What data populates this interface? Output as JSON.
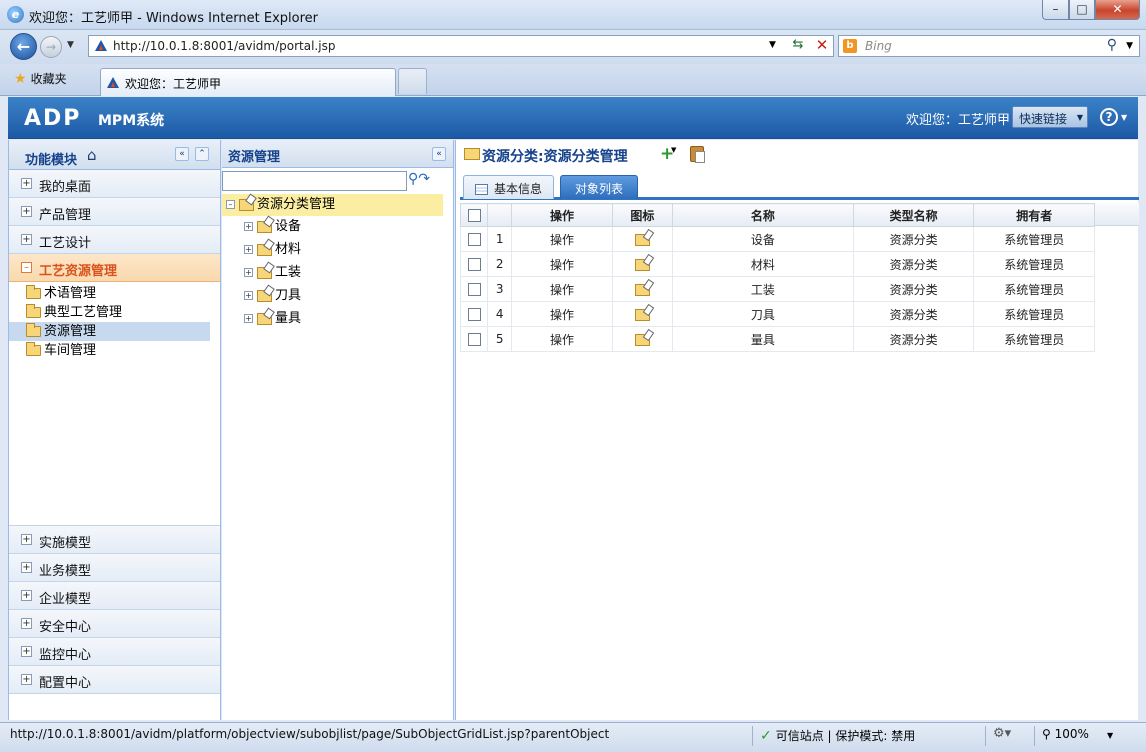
{
  "browser": {
    "window_title": "欢迎您：工艺师甲 - Windows Internet Explorer",
    "url": "http://10.0.1.8:8001/avidm/portal.jsp",
    "search_placeholder": "Bing",
    "favorites_label": "收藏夹",
    "tab_title": "欢迎您：工艺师甲",
    "status_url": "http://10.0.1.8:8001/avidm/platform/objectview/subobjlist/page/SubObjectGridList.jsp?parentObjectId=",
    "trusted_zone": "可信站点 | 保护模式: 禁用",
    "zoom": "100%"
  },
  "app": {
    "logo": "ADP",
    "system_name": "MPM系统",
    "welcome": "欢迎您：工艺师甲",
    "quick_links": "快速链接"
  },
  "left_panel": {
    "title": "功能模块",
    "top_items": [
      {
        "label": "我的桌面"
      },
      {
        "label": "产品管理"
      },
      {
        "label": "工艺设计"
      },
      {
        "label": "工艺资源管理"
      }
    ],
    "sub_items": [
      {
        "label": "术语管理"
      },
      {
        "label": "典型工艺管理"
      },
      {
        "label": "资源管理"
      },
      {
        "label": "车间管理"
      }
    ],
    "bottom_items": [
      {
        "label": "实施模型"
      },
      {
        "label": "业务模型"
      },
      {
        "label": "企业模型"
      },
      {
        "label": "安全中心"
      },
      {
        "label": "监控中心"
      },
      {
        "label": "配置中心"
      }
    ]
  },
  "middle_panel": {
    "title": "资源管理",
    "search_value": "",
    "tree_root": "资源分类管理",
    "tree_children": [
      {
        "label": "设备"
      },
      {
        "label": "材料"
      },
      {
        "label": "工装"
      },
      {
        "label": "刀具"
      },
      {
        "label": "量具"
      }
    ]
  },
  "right_panel": {
    "title": "资源分类:资源分类管理",
    "tabs": [
      {
        "label": "基本信息"
      },
      {
        "label": "对象列表"
      }
    ],
    "columns": [
      "操作",
      "图标",
      "名称",
      "类型名称",
      "拥有者"
    ],
    "rows": [
      {
        "num": "1",
        "action": "操作",
        "name": "设备",
        "type": "资源分类",
        "owner": "系统管理员"
      },
      {
        "num": "2",
        "action": "操作",
        "name": "材料",
        "type": "资源分类",
        "owner": "系统管理员"
      },
      {
        "num": "3",
        "action": "操作",
        "name": "工装",
        "type": "资源分类",
        "owner": "系统管理员"
      },
      {
        "num": "4",
        "action": "操作",
        "name": "刀具",
        "type": "资源分类",
        "owner": "系统管理员"
      },
      {
        "num": "5",
        "action": "操作",
        "name": "量具",
        "type": "资源分类",
        "owner": "系统管理员"
      }
    ]
  }
}
